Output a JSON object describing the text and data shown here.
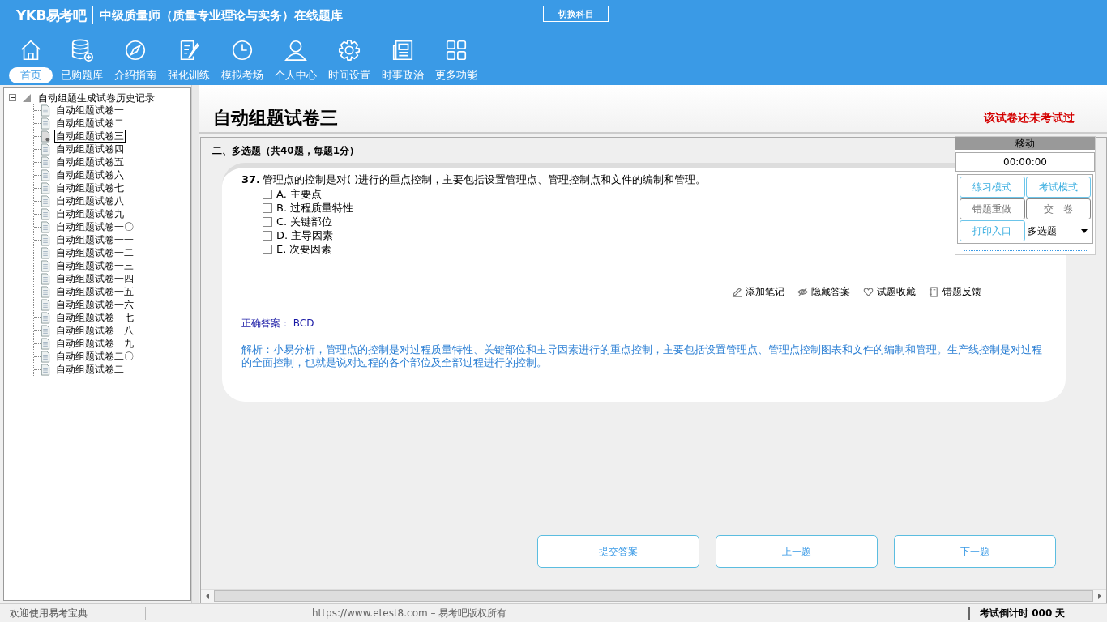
{
  "header": {
    "logo": "YKB易考吧",
    "title": "中级质量师（质量专业理论与实务）在线题库",
    "switch_button": "切换科目"
  },
  "nav": [
    {
      "label": "首页",
      "selected": true
    },
    {
      "label": "已购题库",
      "selected": false
    },
    {
      "label": "介绍指南",
      "selected": false
    },
    {
      "label": "强化训练",
      "selected": false
    },
    {
      "label": "模拟考场",
      "selected": false
    },
    {
      "label": "个人中心",
      "selected": false
    },
    {
      "label": "时间设置",
      "selected": false
    },
    {
      "label": "时事政治",
      "selected": false
    },
    {
      "label": "更多功能",
      "selected": false
    }
  ],
  "tree": {
    "label": "自动组题生成试卷历史记录",
    "expanded": true,
    "children": [
      {
        "label": "自动组题试卷一",
        "selected": false
      },
      {
        "label": "自动组题试卷二",
        "selected": false
      },
      {
        "label": "自动组题试卷三",
        "selected": true
      },
      {
        "label": "自动组题试卷四",
        "selected": false
      },
      {
        "label": "自动组题试卷五",
        "selected": false
      },
      {
        "label": "自动组题试卷六",
        "selected": false
      },
      {
        "label": "自动组题试卷七",
        "selected": false
      },
      {
        "label": "自动组题试卷八",
        "selected": false
      },
      {
        "label": "自动组题试卷九",
        "selected": false
      },
      {
        "label": "自动组题试卷一〇",
        "selected": false
      },
      {
        "label": "自动组题试卷一一",
        "selected": false
      },
      {
        "label": "自动组题试卷一二",
        "selected": false
      },
      {
        "label": "自动组题试卷一三",
        "selected": false
      },
      {
        "label": "自动组题试卷一四",
        "selected": false
      },
      {
        "label": "自动组题试卷一五",
        "selected": false
      },
      {
        "label": "自动组题试卷一六",
        "selected": false
      },
      {
        "label": "自动组题试卷一七",
        "selected": false
      },
      {
        "label": "自动组题试卷一八",
        "selected": false
      },
      {
        "label": "自动组题试卷一九",
        "selected": false
      },
      {
        "label": "自动组题试卷二〇",
        "selected": false
      },
      {
        "label": "自动组题试卷二一",
        "selected": false
      }
    ]
  },
  "paper": {
    "title": "自动组题试卷三",
    "status": "该试卷还未考试过",
    "section": "二、多选题（共40题，每题1分）"
  },
  "question": {
    "number": "37.",
    "text": "管理点的控制是对( )进行的重点控制，主要包括设置管理点、管理控制点和文件的编制和管理。",
    "options": [
      {
        "label": "A. 主要点",
        "checked": false
      },
      {
        "label": "B. 过程质量特性",
        "checked": false
      },
      {
        "label": "C. 关键部位",
        "checked": false
      },
      {
        "label": "D. 主导因素",
        "checked": false
      },
      {
        "label": "E. 次要因素",
        "checked": false
      }
    ],
    "actions": [
      "添加笔记",
      "隐藏答案",
      "试题收藏",
      "错题反馈"
    ],
    "answer_label": "正确答案：",
    "answer": "BCD",
    "analysis": "解析：小易分析，管理点的控制是对过程质量特性、关键部位和主导因素进行的重点控制，主要包括设置管理点、管理点控制图表和文件的编制和管理。生产线控制是对过程的全面控制，也就是说对过程的各个部位及全部过程进行的控制。"
  },
  "side_panel": {
    "move_label": "移动",
    "timer": "00:00:00",
    "buttons": [
      {
        "label": "练习模式",
        "disabled": false
      },
      {
        "label": "考试模式",
        "disabled": false
      },
      {
        "label": "错题重做",
        "disabled": true
      },
      {
        "label": "交　卷",
        "disabled": true
      },
      {
        "label": "打印入口",
        "disabled": false
      }
    ],
    "type_select": "多选题"
  },
  "bottom_buttons": [
    "提交答案",
    "上一题",
    "下一题"
  ],
  "status_bar": {
    "welcome": "欢迎使用易考宝典",
    "copyright": "https://www.etest8.com – 易考吧版权所有",
    "countdown": "考试倒计时 000 天"
  }
}
